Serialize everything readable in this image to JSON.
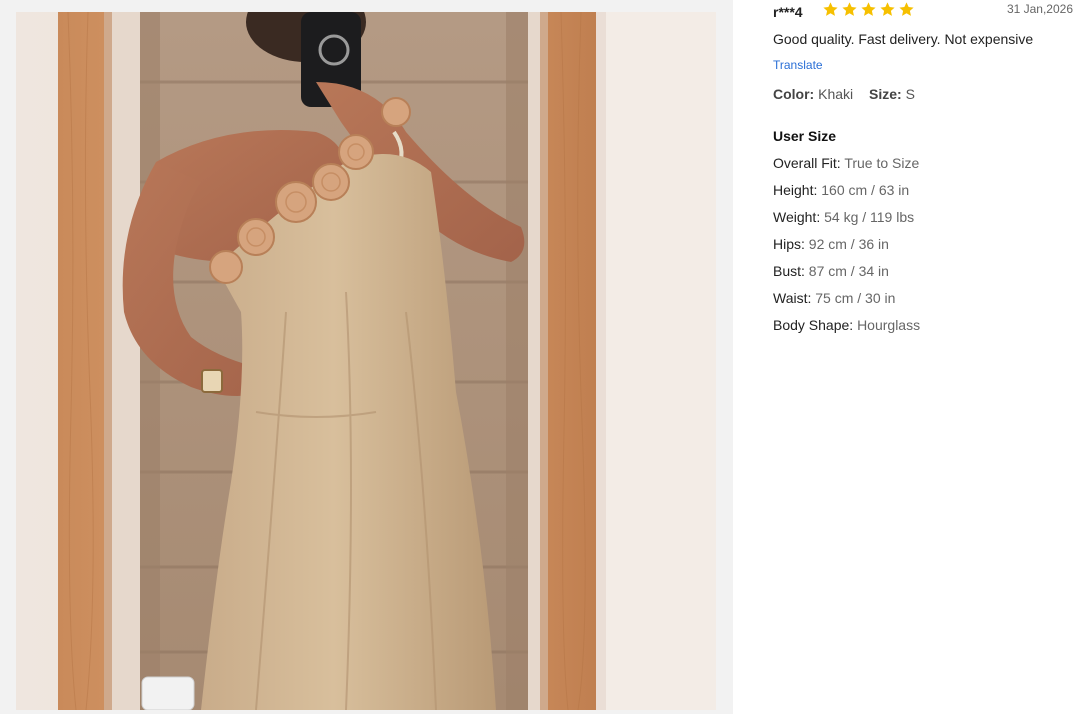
{
  "review": {
    "reviewer": "r***4",
    "rating": 5,
    "date": "31 Jan,2026",
    "text": "Good quality. Fast delivery. Not expensive",
    "translate_label": "Translate",
    "color_label": "Color:",
    "color_value": "Khaki",
    "size_label": "Size:",
    "size_value": "S",
    "star_color": "#f6c000"
  },
  "user_size": {
    "title": "User Size",
    "rows": [
      {
        "label": "Overall Fit:",
        "value": "True to Size"
      },
      {
        "label": "Height:",
        "value": "160 cm / 63 in"
      },
      {
        "label": "Weight:",
        "value": "54 kg / 119 lbs"
      },
      {
        "label": "Hips:",
        "value": "92 cm / 36 in"
      },
      {
        "label": "Bust:",
        "value": "87 cm / 34 in"
      },
      {
        "label": "Waist:",
        "value": "75 cm / 30 in"
      },
      {
        "label": "Body Shape:",
        "value": "Hourglass"
      }
    ]
  }
}
